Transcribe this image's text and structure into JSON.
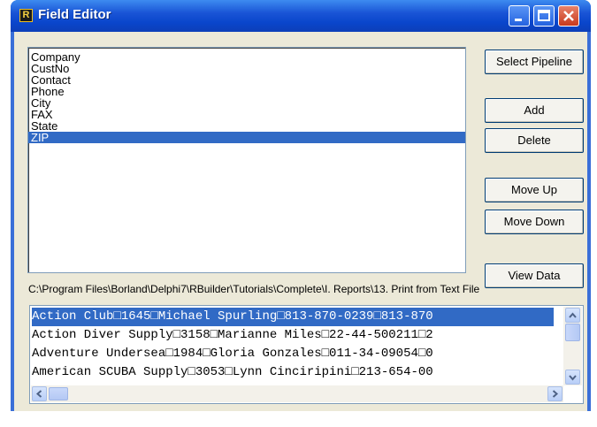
{
  "window": {
    "title": "Field Editor",
    "icon_letter": "R",
    "controls": {
      "minimize": "minimize-icon",
      "maximize": "maximize-icon",
      "close": "close-icon"
    }
  },
  "fields": {
    "items": [
      "Company",
      "CustNo",
      "Contact",
      "Phone",
      "City",
      "FAX",
      "State",
      "ZIP"
    ],
    "selected": "ZIP"
  },
  "buttons": {
    "select_pipeline": "Select Pipeline",
    "add": "Add",
    "delete": "Delete",
    "move_up": "Move Up",
    "move_down": "Move Down",
    "view_data": "View Data"
  },
  "file_path": "C:\\Program Files\\Borland\\Delphi7\\RBuilder\\Tutorials\\Complete\\I. Reports\\13. Print from Text File",
  "data_rows": [
    "Action Club□1645□Michael Spurling□813-870-0239□813-870",
    "Action Diver Supply□3158□Marianne Miles□22-44-500211□2",
    "Adventure Undersea□1984□Gloria Gonzales□011-34-09054□0",
    "American SCUBA Supply□3053□Lynn Cinciripini□213-654-00"
  ],
  "colors": {
    "selection": "#316ac5",
    "titlebar": "#0a46cc",
    "face": "#ece9d8"
  }
}
